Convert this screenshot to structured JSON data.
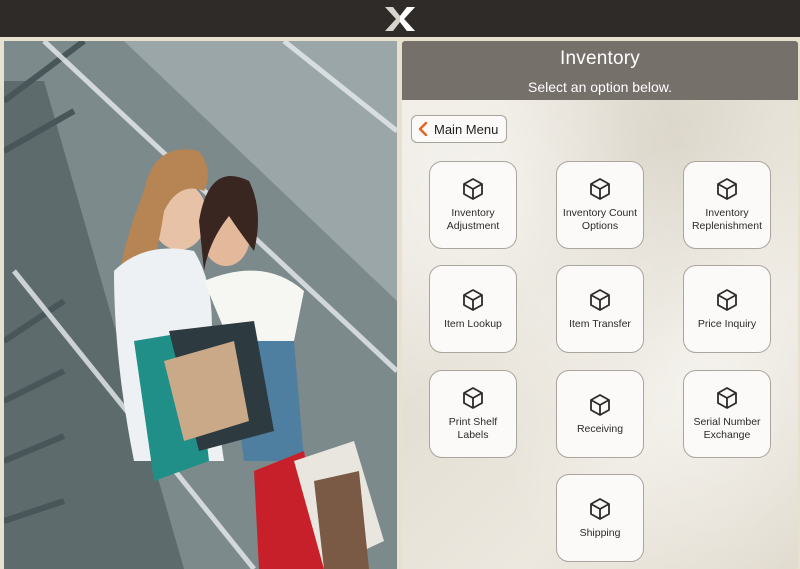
{
  "panel": {
    "title": "Inventory",
    "subtitle": "Select an option below."
  },
  "back_button": {
    "label": "Main Menu"
  },
  "colors": {
    "header_bg": "#76706b",
    "accent_orange": "#e5631b",
    "topbar_bg": "#2f2b29"
  },
  "tiles": [
    {
      "label": "Inventory Adjustment",
      "icon": "cube-icon"
    },
    {
      "label": "Inventory Count Options",
      "icon": "cube-icon"
    },
    {
      "label": "Inventory Replenishment",
      "icon": "cube-icon"
    },
    {
      "label": "Item Lookup",
      "icon": "cube-icon"
    },
    {
      "label": "Item Transfer",
      "icon": "cube-icon"
    },
    {
      "label": "Price Inquiry",
      "icon": "cube-icon"
    },
    {
      "label": "Print Shelf Labels",
      "icon": "cube-icon"
    },
    {
      "label": "Receiving",
      "icon": "cube-icon"
    },
    {
      "label": "Serial Number Exchange",
      "icon": "cube-icon"
    },
    {
      "label": "Shipping",
      "icon": "cube-icon"
    }
  ]
}
